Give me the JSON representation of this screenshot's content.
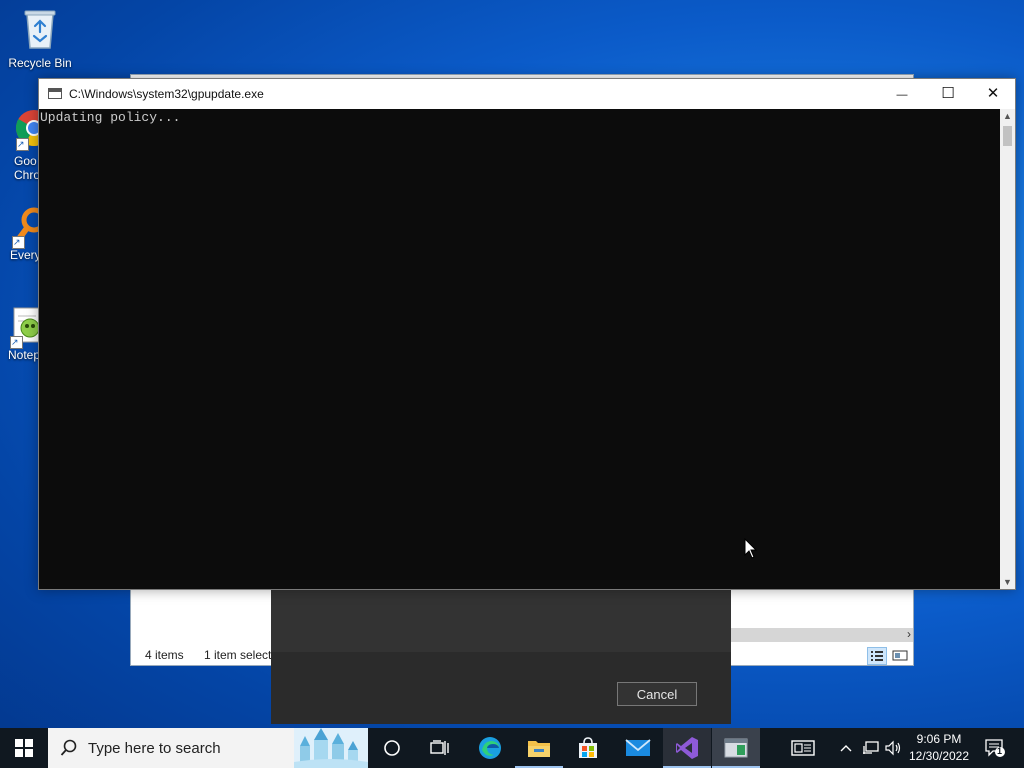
{
  "desktop": {
    "icons": [
      {
        "label": "Recycle Bin",
        "icon": "recycle-bin-icon"
      },
      {
        "label": "Goo\nChro",
        "icon": "chrome-icon"
      },
      {
        "label": "Every",
        "icon": "everything-search-icon"
      },
      {
        "label": "Notep",
        "icon": "notepad-plus-plus-icon"
      }
    ]
  },
  "explorer": {
    "status_items": "4 items",
    "status_selected": "1 item selecte"
  },
  "dialog": {
    "cancel_label": "Cancel"
  },
  "console": {
    "title": "C:\\Windows\\system32\\gpupdate.exe",
    "output": "Updating policy...",
    "minimize_glyph": "—",
    "maximize_glyph": "☐",
    "close_glyph": "✕"
  },
  "taskbar": {
    "search_placeholder": "Type here to search",
    "pinned": [
      "start-icon",
      "cortana-icon",
      "task-view-icon",
      "edge-icon",
      "file-explorer-icon",
      "store-icon",
      "mail-icon",
      "visual-studio-icon",
      "gpupdate-console-icon"
    ],
    "tray": {
      "time": "9:06 PM",
      "date": "12/30/2022",
      "notification_count": "1"
    }
  },
  "colors": {
    "accent": "#0078d7",
    "taskbar_bg": "#101820",
    "console_bg": "#0c0c0c",
    "console_fg": "#cccccc"
  }
}
